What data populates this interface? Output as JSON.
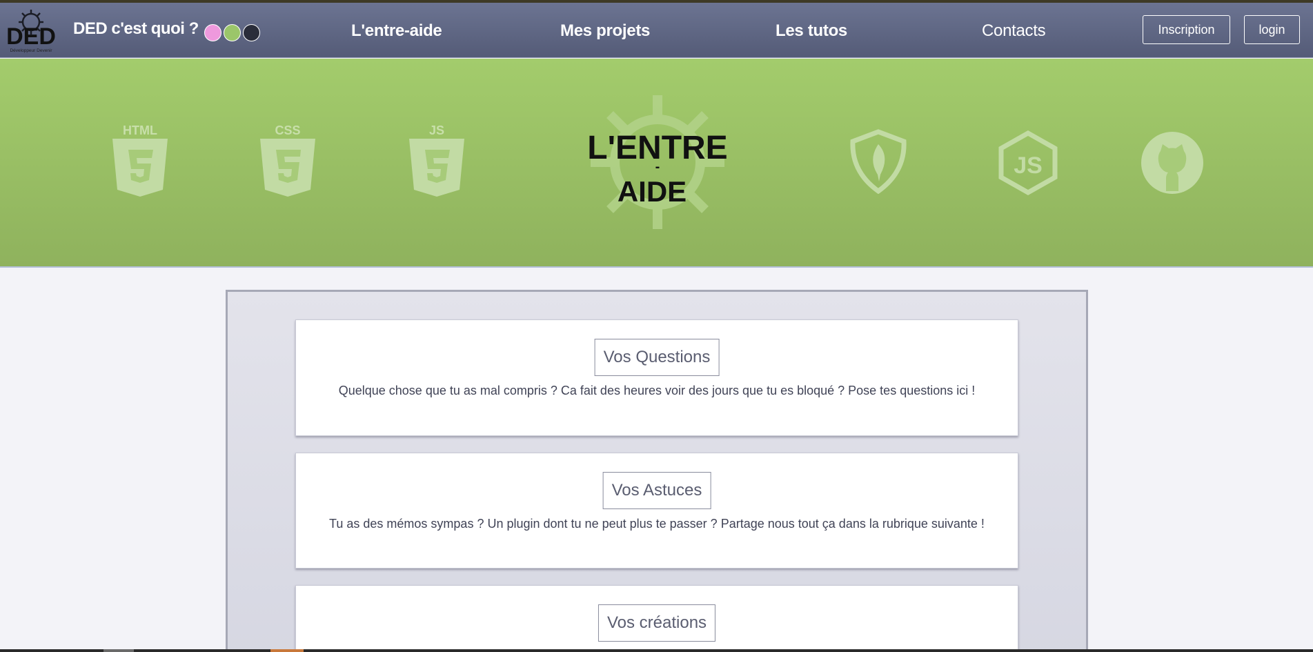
{
  "brand": {
    "logo_text": "DED",
    "logo_subtext": "Développeur Devenir",
    "title": "DED c'est quoi ?",
    "theme_dots": [
      "#ee99dd",
      "#9bc66a",
      "#2a2d3a"
    ]
  },
  "nav": {
    "links": [
      "L'entre-aide",
      "Mes projets",
      "Les tutos",
      "Contacts"
    ],
    "signup_label": "Inscription",
    "login_label": "login"
  },
  "hero": {
    "title_line1": "L'ENTRE",
    "title_dash": "-",
    "title_line2": "AIDE",
    "icons": [
      "html5-icon",
      "css3-icon",
      "javascript-icon",
      "gear-icon",
      "mongodb-icon",
      "nodejs-icon",
      "github-icon"
    ],
    "html_label": "HTML",
    "css_label": "CSS",
    "js_label": "JS"
  },
  "cards": [
    {
      "title": "Vos Questions",
      "description": "Quelque chose que tu as mal compris ? Ca fait des heures voir des jours que tu es bloqué ? Pose tes questions ici !"
    },
    {
      "title": "Vos Astuces",
      "description": "Tu as des mémos sympas ? Un plugin dont tu ne peut plus te passer ? Partage nous tout ça dans la rubrique suivante !"
    },
    {
      "title": "Vos créations",
      "description": ""
    }
  ],
  "colors": {
    "navbar": "#5f6785",
    "hero": "#9bc266",
    "page_bg": "#f3f3f8"
  }
}
